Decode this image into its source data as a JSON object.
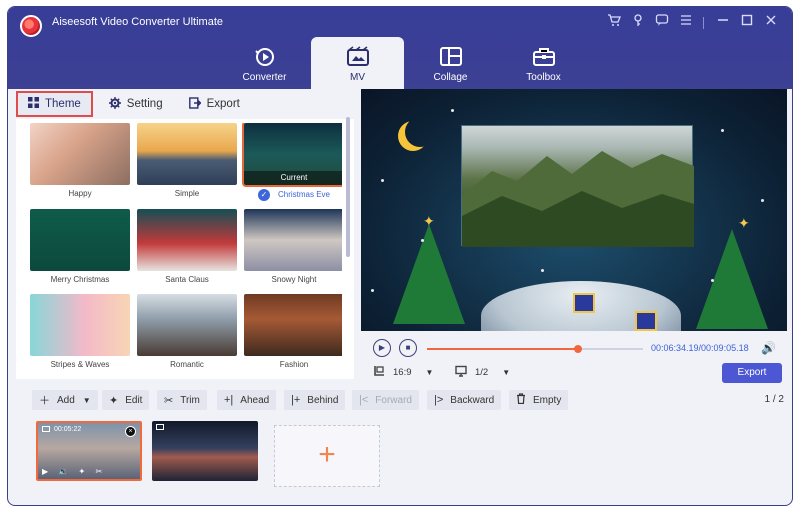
{
  "app": {
    "title": "Aiseesoft Video Converter Ultimate"
  },
  "window_icons": [
    "cart-icon",
    "key-icon",
    "chat-icon",
    "menu-icon",
    "minimize-icon",
    "maximize-icon",
    "close-icon"
  ],
  "nav": {
    "tabs": [
      {
        "label": "Converter",
        "icon": "converter-icon",
        "active": false
      },
      {
        "label": "MV",
        "icon": "mv-icon",
        "active": true
      },
      {
        "label": "Collage",
        "icon": "collage-icon",
        "active": false
      },
      {
        "label": "Toolbox",
        "icon": "toolbox-icon",
        "active": false
      }
    ]
  },
  "subtabs": [
    {
      "label": "Theme",
      "icon": "grid-icon",
      "active": true
    },
    {
      "label": "Setting",
      "icon": "gear-icon",
      "active": false
    },
    {
      "label": "Export",
      "icon": "export-icon",
      "active": false
    }
  ],
  "themes": [
    {
      "name": "Happy"
    },
    {
      "name": "Simple"
    },
    {
      "name": "Christmas Eve",
      "selected": true,
      "badge": "Current"
    },
    {
      "name": "Merry Christmas"
    },
    {
      "name": "Santa Claus"
    },
    {
      "name": "Snowy Night"
    },
    {
      "name": "Stripes & Waves"
    },
    {
      "name": "Romantic"
    },
    {
      "name": "Fashion"
    }
  ],
  "player": {
    "time": "00:06:34.19/00:09:05.18",
    "progress": 0.7,
    "aspect_ratio": "16:9",
    "page": "1/2",
    "export_label": "Export"
  },
  "toolbar": {
    "add": "Add",
    "edit": "Edit",
    "trim": "Trim",
    "ahead": "Ahead",
    "behind": "Behind",
    "forward": "Forward",
    "backward": "Backward",
    "empty": "Empty",
    "page_count": "1 / 2"
  },
  "clips": [
    {
      "time": "00:05:22",
      "selected": true
    },
    {
      "time": "",
      "selected": false
    }
  ],
  "colors": {
    "header": "#383d97",
    "accent_orange": "#f2663f",
    "accent_blue": "#4b57d3",
    "selection_red": "#e04b4b"
  }
}
